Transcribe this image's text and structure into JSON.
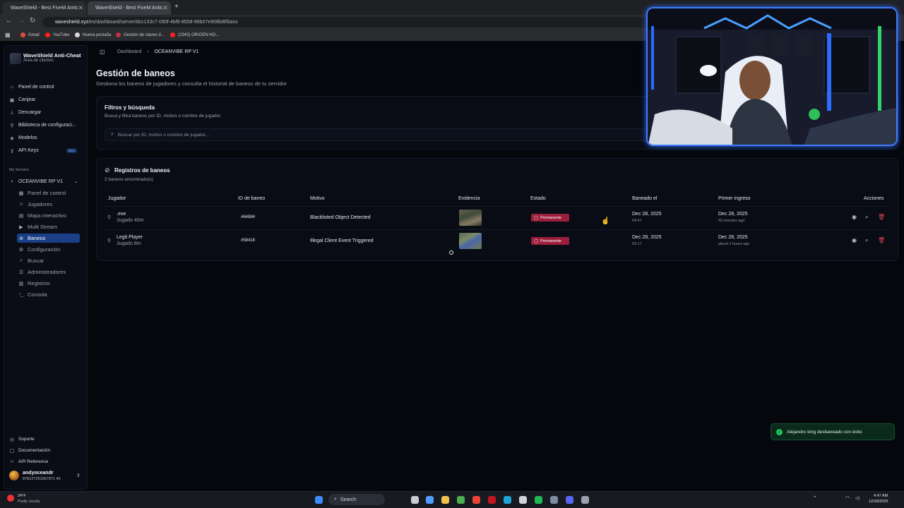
{
  "browser": {
    "tabs": [
      {
        "title": "WaveShield - Best FiveM Antic",
        "close": "✕"
      },
      {
        "title": "WaveShield - Best FiveM Antic",
        "close": "✕"
      }
    ],
    "new_tab": "+",
    "url_host": "waveshield.xyz",
    "url_path": "/es/dashboard/server/dcc133c7-090f-4bf8-8558-66b07e908b8f/bans",
    "bookmarks": [
      "Gmail",
      "YouTube",
      "Nueva pestaña",
      "Gestión de claves d...",
      "(2343) ORIGEN HO..."
    ]
  },
  "sidebar": {
    "brand_title": "WaveShield Anti-Cheat",
    "brand_subtitle": "Área de clientes",
    "main_items": [
      {
        "label": "Panel de control",
        "icon": "⌂"
      },
      {
        "label": "Canjear",
        "icon": "▣"
      },
      {
        "label": "Descargar",
        "icon": "⤓"
      },
      {
        "label": "Biblioteca de configuraci...",
        "icon": "⚲"
      },
      {
        "label": "Modelos",
        "icon": "◈"
      },
      {
        "label": "API Keys",
        "icon": "⚷",
        "badge": "Beta"
      }
    ],
    "section_label": "My Servers",
    "server_name": "OCEANVIBE RP V1",
    "server_items": [
      {
        "label": "Panel de control",
        "icon": "▦"
      },
      {
        "label": "Jugadores",
        "icon": "☺"
      },
      {
        "label": "Mapa interactivo",
        "icon": "▤"
      },
      {
        "label": "Multi Stream",
        "icon": "▶"
      },
      {
        "label": "Baneos",
        "icon": "⊘",
        "active": true
      },
      {
        "label": "Configuración",
        "icon": "⚙"
      },
      {
        "label": "Buscar",
        "icon": "⌕"
      },
      {
        "label": "Administradores",
        "icon": "☰"
      },
      {
        "label": "Registros",
        "icon": "▥"
      },
      {
        "label": "Consola",
        "icon": "›_"
      }
    ],
    "footer_items": [
      {
        "label": "Soporte",
        "icon": "◎"
      },
      {
        "label": "Documentación",
        "icon": "▢"
      },
      {
        "label": "API Reference",
        "icon": "‹›"
      }
    ],
    "user_name": "andyoceandr",
    "user_id": "878127291057971 40"
  },
  "header": {
    "breadcrumb_root": "Dashboard",
    "breadcrumb_sep": "›",
    "breadcrumb_current": "OCEANVIBE RP V1",
    "title": "Gestión de baneos",
    "subtitle": "Gestiona los baneos de jugadores y consulta el historial de baneos de tu servidor"
  },
  "filters": {
    "title": "Filtros y búsqueda",
    "subtitle": "Busca y filtra baneos por ID, motivo o nombre de jugador",
    "search_placeholder": "Buscar por ID, motivo o nombre de jugador..."
  },
  "bans": {
    "title": "Registros de baneos",
    "count_text": "2 baneos encontrado(s)",
    "columns": [
      "Jugador",
      "ID de baneo",
      "Motivo",
      "Evidencia",
      "Estado",
      "Baneado el",
      "Primer ingreso",
      "Acciones"
    ],
    "rows": [
      {
        "player": ".exe",
        "played": "Jugado 40m",
        "ban_id": "#64884",
        "reason": "Blacklisted Object Detected",
        "status": "Permanente",
        "banned_date": "Dec 28, 2025",
        "banned_time": "04:47",
        "first_date": "Dec 28, 2025",
        "first_rel": "43 minutes ago"
      },
      {
        "player": "Legit Player",
        "played": "Jugado 8m",
        "ban_id": "#58418",
        "reason": "Illegal Client Event Triggered",
        "status": "Permanente",
        "banned_date": "Dec 28, 2025",
        "banned_time": "03:17",
        "first_date": "Dec 28, 2025",
        "first_rel": "about 2 hours ago"
      }
    ]
  },
  "toast": {
    "text": "Alejandro king desbaneado con éxito",
    "icon": "✓"
  },
  "taskbar": {
    "weather_temp": "24°F",
    "weather_desc": "Partly cloudy",
    "search_label": "Search",
    "time": "4:47 AM",
    "date": "12/28/2025"
  },
  "colors": {
    "accent": "#1a3f86",
    "status_permanent": "#9b1f3c",
    "toast_bg": "#0b2a1c",
    "webcam_border": "#3f7bff"
  }
}
